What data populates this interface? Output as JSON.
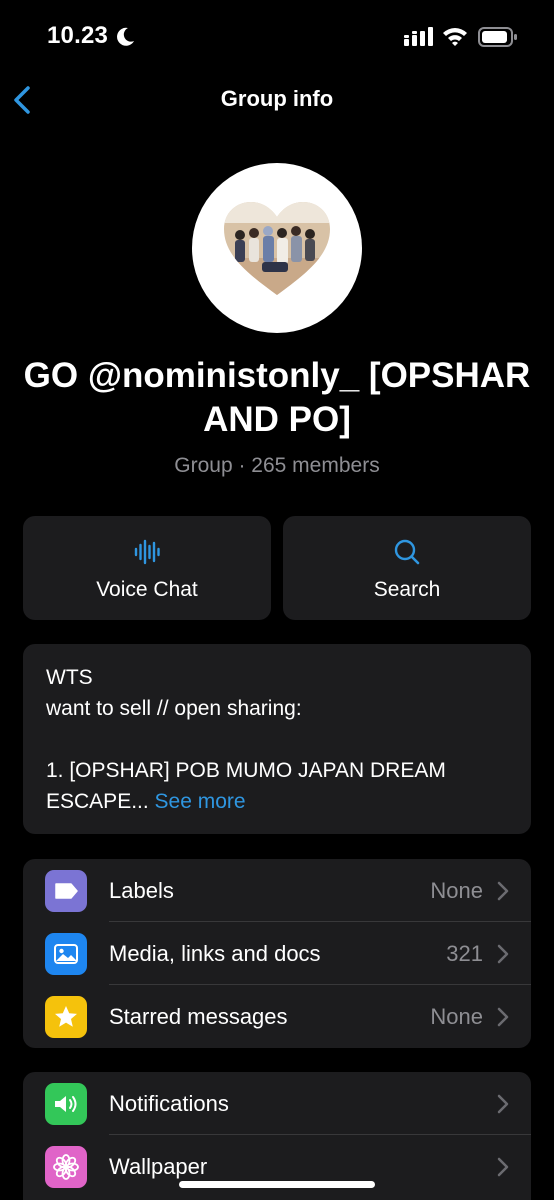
{
  "status_bar": {
    "time": "10.23"
  },
  "nav": {
    "title": "Group info"
  },
  "group": {
    "name": "GO @noministonly_ [OPSHAR AND PO]",
    "subtitle": "Group · 265 members"
  },
  "actions": [
    {
      "label": "Voice Chat",
      "icon": "waveform-icon"
    },
    {
      "label": "Search",
      "icon": "search-icon"
    }
  ],
  "description": {
    "text": "WTS\nwant to sell // open sharing:\n\n1. [OPSHAR] POB MUMO JAPAN DREAM ESCAPE...",
    "see_more": "See more"
  },
  "list_group_1": [
    {
      "label": "Labels",
      "value": "None",
      "icon": "label-icon",
      "color": "#7b74d4"
    },
    {
      "label": "Media, links and docs",
      "value": "321",
      "icon": "photo-icon",
      "color": "#1e86f0"
    },
    {
      "label": "Starred messages",
      "value": "None",
      "icon": "star-icon",
      "color": "#f5c20c"
    }
  ],
  "list_group_2": [
    {
      "label": "Notifications",
      "value": "",
      "icon": "speaker-icon",
      "color": "#33c759"
    },
    {
      "label": "Wallpaper",
      "value": "",
      "icon": "flower-icon",
      "color": "#e064c8"
    }
  ],
  "colors": {
    "accent": "#2f96e0",
    "card": "#1c1c1e",
    "secondary_text": "#8e8e93"
  }
}
